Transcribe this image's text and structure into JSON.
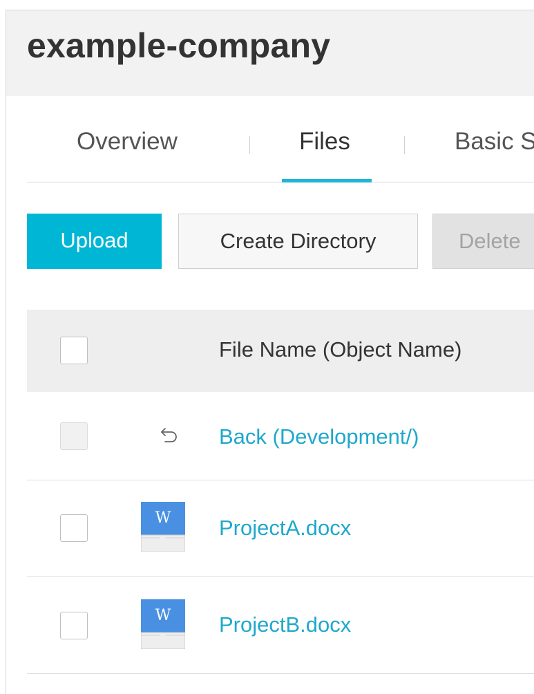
{
  "header": {
    "title": "example-company"
  },
  "tabs": [
    {
      "label": "Overview",
      "active": false
    },
    {
      "label": "Files",
      "active": true
    },
    {
      "label": "Basic S",
      "active": false
    }
  ],
  "toolbar": {
    "upload_label": "Upload",
    "create_directory_label": "Create Directory",
    "delete_label": "Delete",
    "delete_disabled": true
  },
  "table": {
    "columns": [
      "File Name (Object Name)"
    ],
    "rows": [
      {
        "type": "back",
        "name": "Back (Development/)",
        "icon": "back-arrow-icon",
        "checkbox_disabled": true
      },
      {
        "type": "file",
        "name": "ProjectA.docx",
        "icon": "word-document-icon",
        "checkbox_disabled": false
      },
      {
        "type": "file",
        "name": "ProjectB.docx",
        "icon": "word-document-icon",
        "checkbox_disabled": false
      }
    ]
  },
  "colors": {
    "accent": "#00b6d5",
    "link": "#1fa8cc",
    "word_icon": "#4a90e2"
  }
}
